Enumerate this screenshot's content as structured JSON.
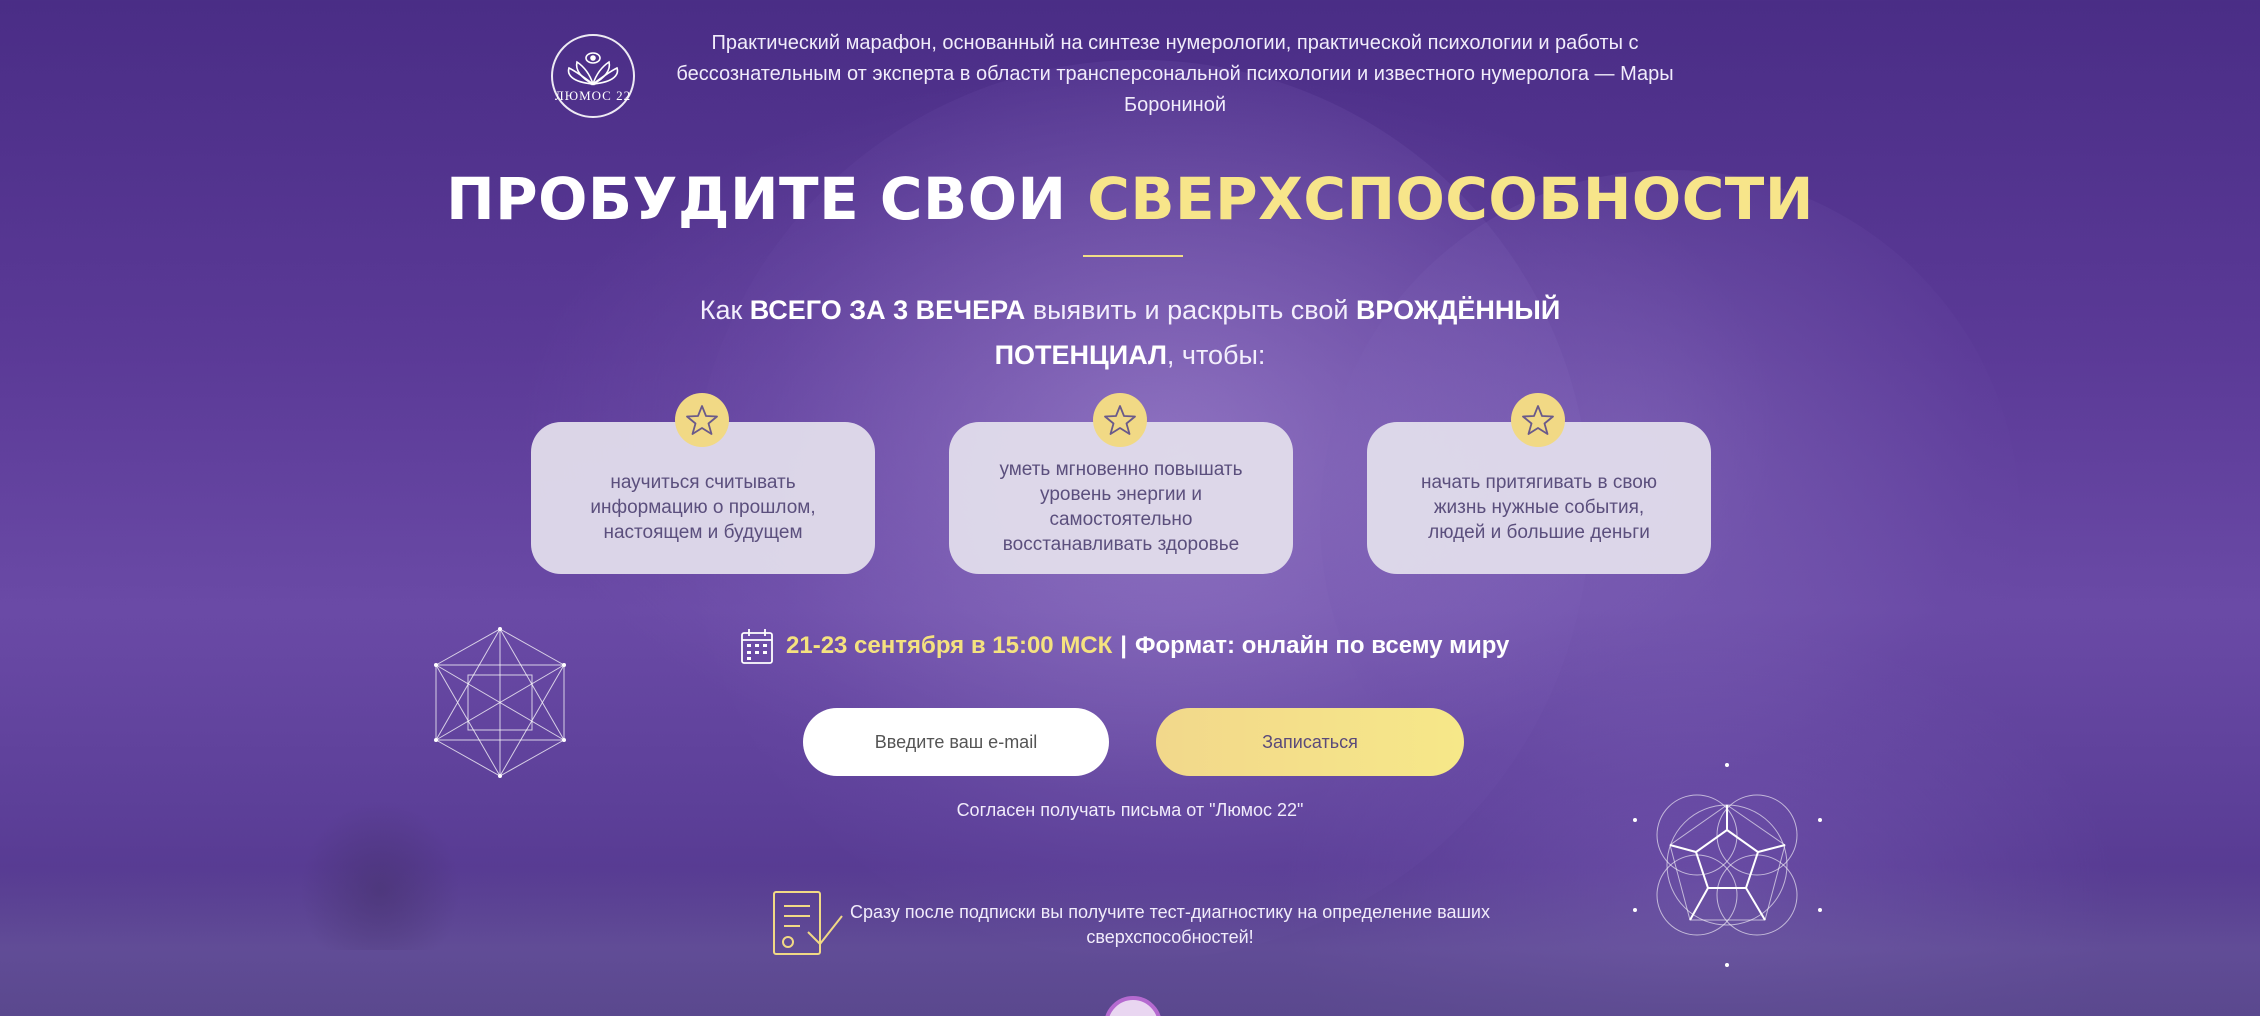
{
  "header": {
    "logo_text": "ЛЮМОС 22",
    "intro": "Практический марафон, основанный на синтезе нумерологии, практической психологии и работы с бессознательным от эксперта в области трансперсональной психологии и известного нумеролога — Мары Борониной"
  },
  "headline": {
    "part1": "ПРОБУДИТЕ СВОИ",
    "part2": "СВЕРХСПОСОБНОСТИ"
  },
  "subheadline": {
    "t1": "Как ",
    "b1": "ВСЕГО ЗА 3 ВЕЧЕРА",
    "t2": " выявить и раскрыть свой ",
    "b2": "ВРОЖДЁННЫЙ ПОТЕНЦИАЛ",
    "t3": ", чтобы:"
  },
  "benefits": [
    {
      "text": "научиться считывать информацию о прошлом, настоящем и будущем",
      "icon": "star-icon"
    },
    {
      "text": "уметь мгновенно повышать уровень энергии и самостоятельно восстанавливать здоровье",
      "icon": "star-icon"
    },
    {
      "text": "начать притягивать в свою жизнь нужные события, людей и большие деньги",
      "icon": "star-icon"
    }
  ],
  "event": {
    "date": "21-23 сентября в 15:00 МСК",
    "separator": "|",
    "format": "Формат: онлайн по всему миру",
    "icon": "calendar-icon"
  },
  "form": {
    "email_placeholder": "Введите ваш e-mail",
    "email_value": "",
    "submit_label": "Записаться",
    "consent": "Согласен получать письма от \"Люмос 22\""
  },
  "bonus": {
    "text": "Сразу после подписки вы получите тест-диагностику на определение ваших сверхспособностей!",
    "icon": "certificate-icon"
  },
  "colors": {
    "accent_yellow": "#f7e58a",
    "background_purple": "#5b3a97",
    "card_bg": "#e2deec",
    "card_text": "#5b4f7d"
  }
}
